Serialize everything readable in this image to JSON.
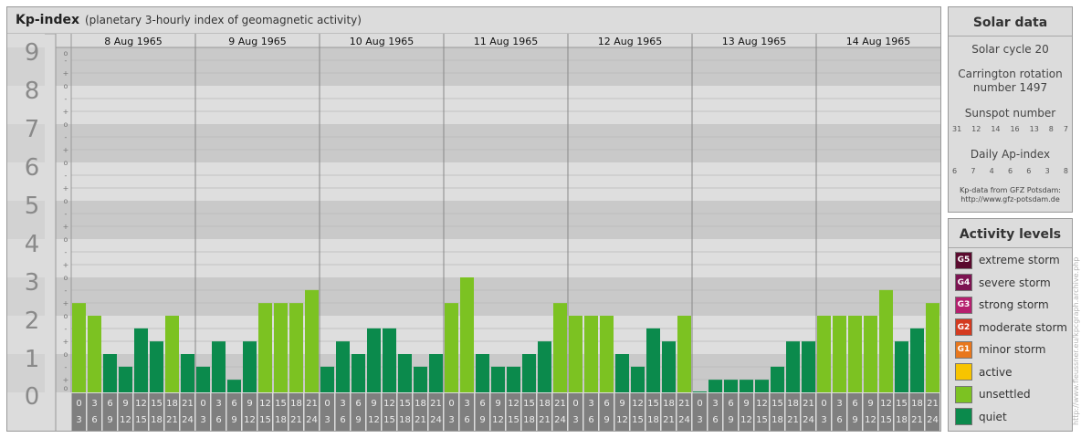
{
  "header": {
    "title": "Kp-index",
    "subtitle": "(planetary 3-hourly index of geomagnetic activity)"
  },
  "chart_data": {
    "type": "bar",
    "title": "Kp-index",
    "subtitle": "(planetary 3-hourly index of geomagnetic activity)",
    "ylim": [
      0,
      9
    ],
    "y_ticks": [
      "0",
      "1",
      "2",
      "3",
      "4",
      "5",
      "6",
      "7",
      "8",
      "9"
    ],
    "y_minor_labels": [
      "o",
      "+",
      "-"
    ],
    "days": [
      "8 Aug 1965",
      "9 Aug 1965",
      "10 Aug 1965",
      "11 Aug 1965",
      "12 Aug 1965",
      "13 Aug 1965",
      "14 Aug 1965"
    ],
    "interval_start": [
      "0",
      "3",
      "6",
      "9",
      "12",
      "15",
      "18",
      "21"
    ],
    "interval_end": [
      "3",
      "6",
      "9",
      "12",
      "15",
      "18",
      "21",
      "24"
    ],
    "values": [
      2.33,
      2.0,
      1.0,
      0.67,
      1.67,
      1.33,
      2.0,
      1.0,
      0.67,
      1.33,
      0.33,
      1.33,
      2.33,
      2.33,
      2.33,
      2.67,
      0.67,
      1.33,
      1.0,
      1.67,
      1.67,
      1.0,
      0.67,
      1.0,
      2.33,
      3.0,
      1.0,
      0.67,
      0.67,
      1.0,
      1.33,
      2.33,
      2.0,
      2.0,
      2.0,
      1.0,
      0.67,
      1.67,
      1.33,
      2.0,
      0.0,
      0.33,
      0.33,
      0.33,
      0.33,
      0.67,
      1.33,
      1.33,
      2.0,
      2.0,
      2.0,
      2.0,
      2.67,
      1.33,
      1.67,
      2.33
    ],
    "colors": {
      "quiet": "#0b8a4c",
      "unsettled": "#7cc222",
      "active": "#f7c400",
      "band_dark": "#c9c9c9",
      "band_light": "#dedede",
      "axis_panel": "#7f7f7f",
      "axis_text": "#eeeeee"
    }
  },
  "solar": {
    "title": "Solar data",
    "cycle": "Solar cycle 20",
    "carrington_line1": "Carrington rotation",
    "carrington_line2": "number 1497",
    "sunspot_title": "Sunspot number",
    "sunspot_values": [
      "31",
      "12",
      "14",
      "16",
      "13",
      "8",
      "7"
    ],
    "ap_title": "Daily Ap-index",
    "ap_values": [
      "6",
      "7",
      "4",
      "6",
      "6",
      "3",
      "8"
    ],
    "source_line1": "Kp-data from GFZ Potsdam:",
    "source_line2": "http://www.gfz-potsdam.de"
  },
  "activity": {
    "title": "Activity levels",
    "items": [
      {
        "code": "G5",
        "label": "extreme storm",
        "color": "#5a0a2e"
      },
      {
        "code": "G4",
        "label": "severe storm",
        "color": "#7d1452"
      },
      {
        "code": "G3",
        "label": "strong storm",
        "color": "#b5206e"
      },
      {
        "code": "G2",
        "label": "moderate storm",
        "color": "#d43a1f"
      },
      {
        "code": "G1",
        "label": "minor storm",
        "color": "#e8771c"
      },
      {
        "code": "",
        "label": "active",
        "color": "#f7c400"
      },
      {
        "code": "",
        "label": "unsettled",
        "color": "#7cc222"
      },
      {
        "code": "",
        "label": "quiet",
        "color": "#0b8a4c"
      }
    ]
  },
  "watermark": "http://www.fleussner.eu/kpcgraph.archive.php"
}
